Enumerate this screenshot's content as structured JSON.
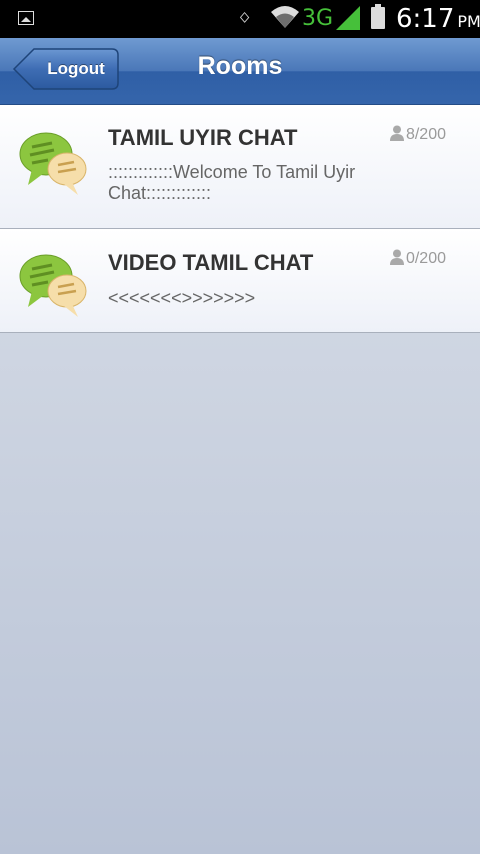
{
  "status_bar": {
    "network": "3G",
    "time": "6:17",
    "ampm": "PM",
    "icons": [
      "picture-notification-icon",
      "bluetooth-icon",
      "wifi-icon",
      "signal-icon",
      "battery-icon"
    ],
    "network_color": "#46c03a"
  },
  "nav": {
    "back_label": "Logout",
    "title": "Rooms"
  },
  "rooms": [
    {
      "name": "TAMIL UYIR CHAT",
      "count": "8/200",
      "description": ":::::::::::::Welcome To Tamil Uyir Chat:::::::::::::"
    },
    {
      "name": "VIDEO TAMIL CHAT",
      "count": "0/200",
      "description": "<<<<<<<>>>>>>>"
    }
  ],
  "colors": {
    "navbar": "#3565ab",
    "chat_icon_green": "#8cc63f",
    "chat_icon_cream": "#f6deaa"
  }
}
